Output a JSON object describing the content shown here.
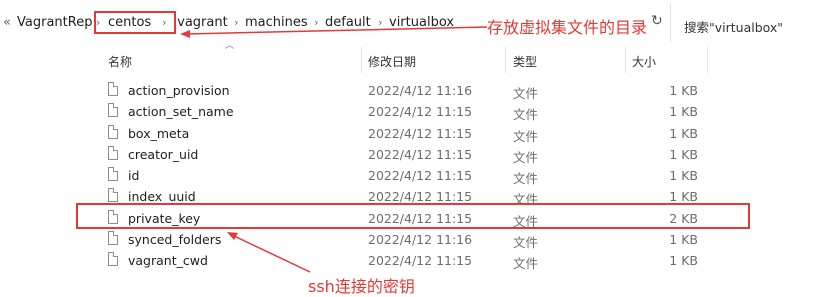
{
  "address": {
    "nav_prev": "«",
    "crumbs": [
      "VagrantRep",
      "centos",
      ".vagrant",
      "machines",
      "default",
      "virtualbox"
    ],
    "search_placeholder": "搜索\"virtualbox\""
  },
  "columns": {
    "name": "名称",
    "modified": "修改日期",
    "type": "类型",
    "size": "大小"
  },
  "files": [
    {
      "name": "action_provision",
      "modified": "2022/4/12 11:16",
      "type": "文件",
      "size": "1 KB"
    },
    {
      "name": "action_set_name",
      "modified": "2022/4/12 11:15",
      "type": "文件",
      "size": "1 KB"
    },
    {
      "name": "box_meta",
      "modified": "2022/4/12 11:15",
      "type": "文件",
      "size": "1 KB"
    },
    {
      "name": "creator_uid",
      "modified": "2022/4/12 11:15",
      "type": "文件",
      "size": "1 KB"
    },
    {
      "name": "id",
      "modified": "2022/4/12 11:15",
      "type": "文件",
      "size": "1 KB"
    },
    {
      "name": "index_uuid",
      "modified": "2022/4/12 11:15",
      "type": "文件",
      "size": "1 KB"
    },
    {
      "name": "private_key",
      "modified": "2022/4/12 11:15",
      "type": "文件",
      "size": "2 KB"
    },
    {
      "name": "synced_folders",
      "modified": "2022/4/12 11:16",
      "type": "文件",
      "size": "1 KB"
    },
    {
      "name": "vagrant_cwd",
      "modified": "2022/4/12 11:15",
      "type": "文件",
      "size": "1 KB"
    }
  ],
  "annotations": {
    "vm_dir": "存放虚拟集文件的目录",
    "ssh_key": "ssh连接的密钥",
    "color": "#e53935"
  }
}
